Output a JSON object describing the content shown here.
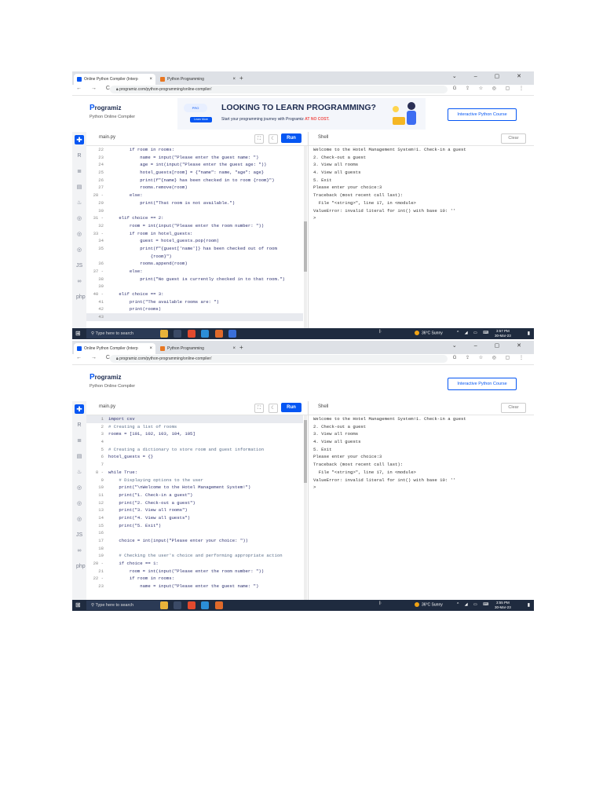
{
  "browser": {
    "tabs": [
      {
        "label": "Online Python Compiler (Interp",
        "color": "#0556f3"
      },
      {
        "label": "Python Programming",
        "color": "#e87722"
      }
    ],
    "url": "programiz.com/python-programming/online-compiler/"
  },
  "site": {
    "logo": "rogramiz",
    "logo_mark": "P",
    "subtitle": "Python Online Compiler",
    "banner_title": "LOOKING TO LEARN PROGRAMMING?",
    "banner_sub": "Start your programming journey with Programiz ",
    "banner_sub_em": "AT NO COST.",
    "banner_btn": "Learn More",
    "course_btn": "Interactive Python Course"
  },
  "editor": {
    "file": "main.py",
    "run": "Run",
    "shell": "Shell",
    "clear": "Clear"
  },
  "shot1_code": [
    {
      "n": "22",
      "t": "        if room in rooms:"
    },
    {
      "n": "23",
      "t": "            name = input(\"Please enter the guest name: \")"
    },
    {
      "n": "24",
      "t": "            age = int(input(\"Please enter the guest age: \"))"
    },
    {
      "n": "25",
      "t": "            hotel_guests[room] = {\"name\": name, \"age\": age}"
    },
    {
      "n": "26",
      "t": "            print(f\"{name} has been checked in to room {room}\")"
    },
    {
      "n": "27",
      "t": "            rooms.remove(room)"
    },
    {
      "n": "28 -",
      "t": "        else:"
    },
    {
      "n": "29",
      "t": "            print(\"That room is not available.\")"
    },
    {
      "n": "30",
      "t": ""
    },
    {
      "n": "31 -",
      "t": "    elif choice == 2:"
    },
    {
      "n": "32",
      "t": "        room = int(input(\"Please enter the room number: \"))"
    },
    {
      "n": "33 -",
      "t": "        if room in hotel_guests:"
    },
    {
      "n": "34",
      "t": "            guest = hotel_guests.pop(room)"
    },
    {
      "n": "35",
      "t": "            print(f\"{guest['name']} has been checked out of room"
    },
    {
      "n": "",
      "t": "                {room}\")"
    },
    {
      "n": "36",
      "t": "            rooms.append(room)"
    },
    {
      "n": "37 -",
      "t": "        else:"
    },
    {
      "n": "38",
      "t": "            print(\"No guest is currently checked in to that room.\")"
    },
    {
      "n": "39",
      "t": ""
    },
    {
      "n": "40 -",
      "t": "    elif choice == 3:"
    },
    {
      "n": "41",
      "t": "        print(\"The available rooms are: \")"
    },
    {
      "n": "42",
      "t": "        print(rooms)"
    },
    {
      "n": "43",
      "t": ""
    }
  ],
  "shot2_code": [
    {
      "n": "1",
      "t": "import csv"
    },
    {
      "n": "2",
      "t": "# Creating a list of rooms",
      "c": true
    },
    {
      "n": "3",
      "t": "rooms = [101, 102, 103, 104, 105]"
    },
    {
      "n": "4",
      "t": ""
    },
    {
      "n": "5",
      "t": "# Creating a dictionary to store room and guest information",
      "c": true
    },
    {
      "n": "6",
      "t": "hotel_guests = {}"
    },
    {
      "n": "7",
      "t": ""
    },
    {
      "n": "8 -",
      "t": "while True:"
    },
    {
      "n": "9",
      "t": "    # Displaying options to the user",
      "c": true
    },
    {
      "n": "10",
      "t": "    print(\"\\nWelcome to the Hotel Management System!\")"
    },
    {
      "n": "11",
      "t": "    print(\"1. Check-in a guest\")"
    },
    {
      "n": "12",
      "t": "    print(\"2. Check-out a guest\")"
    },
    {
      "n": "13",
      "t": "    print(\"3. View all rooms\")"
    },
    {
      "n": "14",
      "t": "    print(\"4. View all guests\")"
    },
    {
      "n": "15",
      "t": "    print(\"5. Exit\")"
    },
    {
      "n": "16",
      "t": ""
    },
    {
      "n": "17",
      "t": "    choice = int(input(\"Please enter your choice: \"))"
    },
    {
      "n": "18",
      "t": ""
    },
    {
      "n": "19",
      "t": "    # Checking the user's choice and performing appropriate action",
      "c": true
    },
    {
      "n": "20 -",
      "t": "    if choice == 1:"
    },
    {
      "n": "21",
      "t": "        room = int(input(\"Please enter the room number: \"))"
    },
    {
      "n": "22 -",
      "t": "        if room in rooms:"
    },
    {
      "n": "23",
      "t": "            name = input(\"Please enter the guest name: \")"
    }
  ],
  "shell_output": [
    "Welcome to the Hotel Management System!1. Check-in a guest",
    "2. Check-out a guest",
    "3. View all rooms",
    "4. View all guests",
    "5. Exit",
    "Please enter your choice:3",
    "Traceback (most recent call last):",
    "  File \"<string>\", line 17, in <module>",
    "ValueError: invalid literal for int() with base 10: ''",
    ">"
  ],
  "taskbar": {
    "search": "Type here to search",
    "weather": "36°C  Sunny",
    "time1": "3:57 PM",
    "time2": "3:55 PM",
    "date": "30-Mar-23"
  },
  "icons": [
    "windows-icon",
    "search-icon",
    "back-icon",
    "forward-icon",
    "reload-icon",
    "lock-icon",
    "home-icon"
  ]
}
